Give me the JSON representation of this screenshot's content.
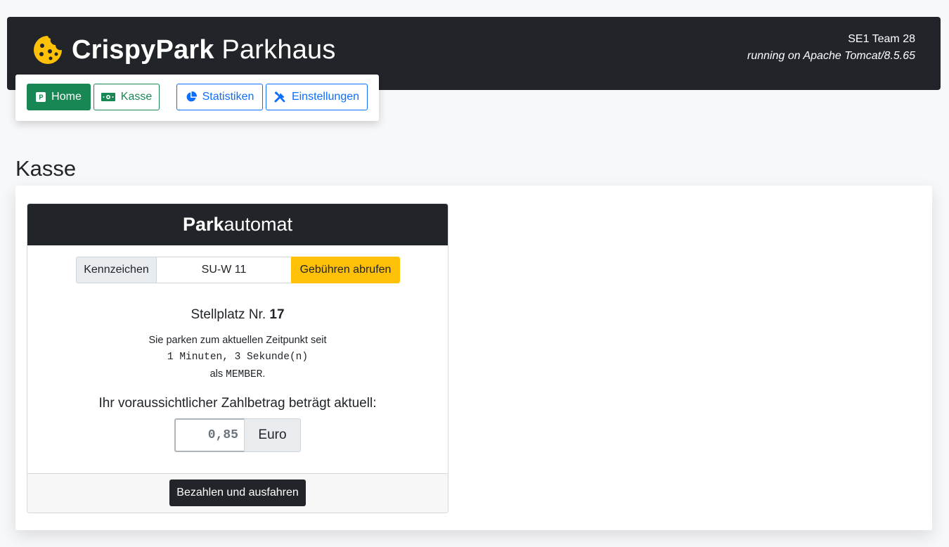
{
  "header": {
    "brand_bold": "CrispyPark",
    "brand_rest": " Parkhaus",
    "logo_icon": "cookie-icon",
    "meta_line1": "SE1 Team 28",
    "meta_line2": "running on Apache Tomcat/8.5.65"
  },
  "nav": {
    "home": {
      "label": "Home",
      "icon": "parking-icon"
    },
    "kasse": {
      "label": "Kasse",
      "icon": "money-icon"
    },
    "stats": {
      "label": "Statistiken",
      "icon": "pie-chart-icon"
    },
    "settings": {
      "label": "Einstellungen",
      "icon": "tools-icon"
    }
  },
  "page_title": "Kasse",
  "machine": {
    "title_bold": "Park",
    "title_rest": "automat",
    "plate_label": "Kennzeichen",
    "plate_value": "SU-W 11",
    "fetch_button": "Gebühren abrufen",
    "spot_prefix": "Stellplatz Nr. ",
    "spot_number": "17",
    "since_text": "Sie parken zum aktuellen Zeitpunkt seit",
    "duration": "1 Minuten, 3 Sekunde(n)",
    "as_prefix": "als ",
    "member_type": "MEMBER",
    "as_suffix": ".",
    "amount_label": "Ihr voraussichtlicher Zahlbetrag beträgt aktuell:",
    "amount_value": "0,85",
    "amount_unit": "Euro",
    "pay_button": "Bezahlen und ausfahren"
  },
  "colors": {
    "dark": "#212529",
    "success": "#198754",
    "primary": "#0d6efd",
    "warning": "#ffc107",
    "cookie": "#ffc107"
  }
}
